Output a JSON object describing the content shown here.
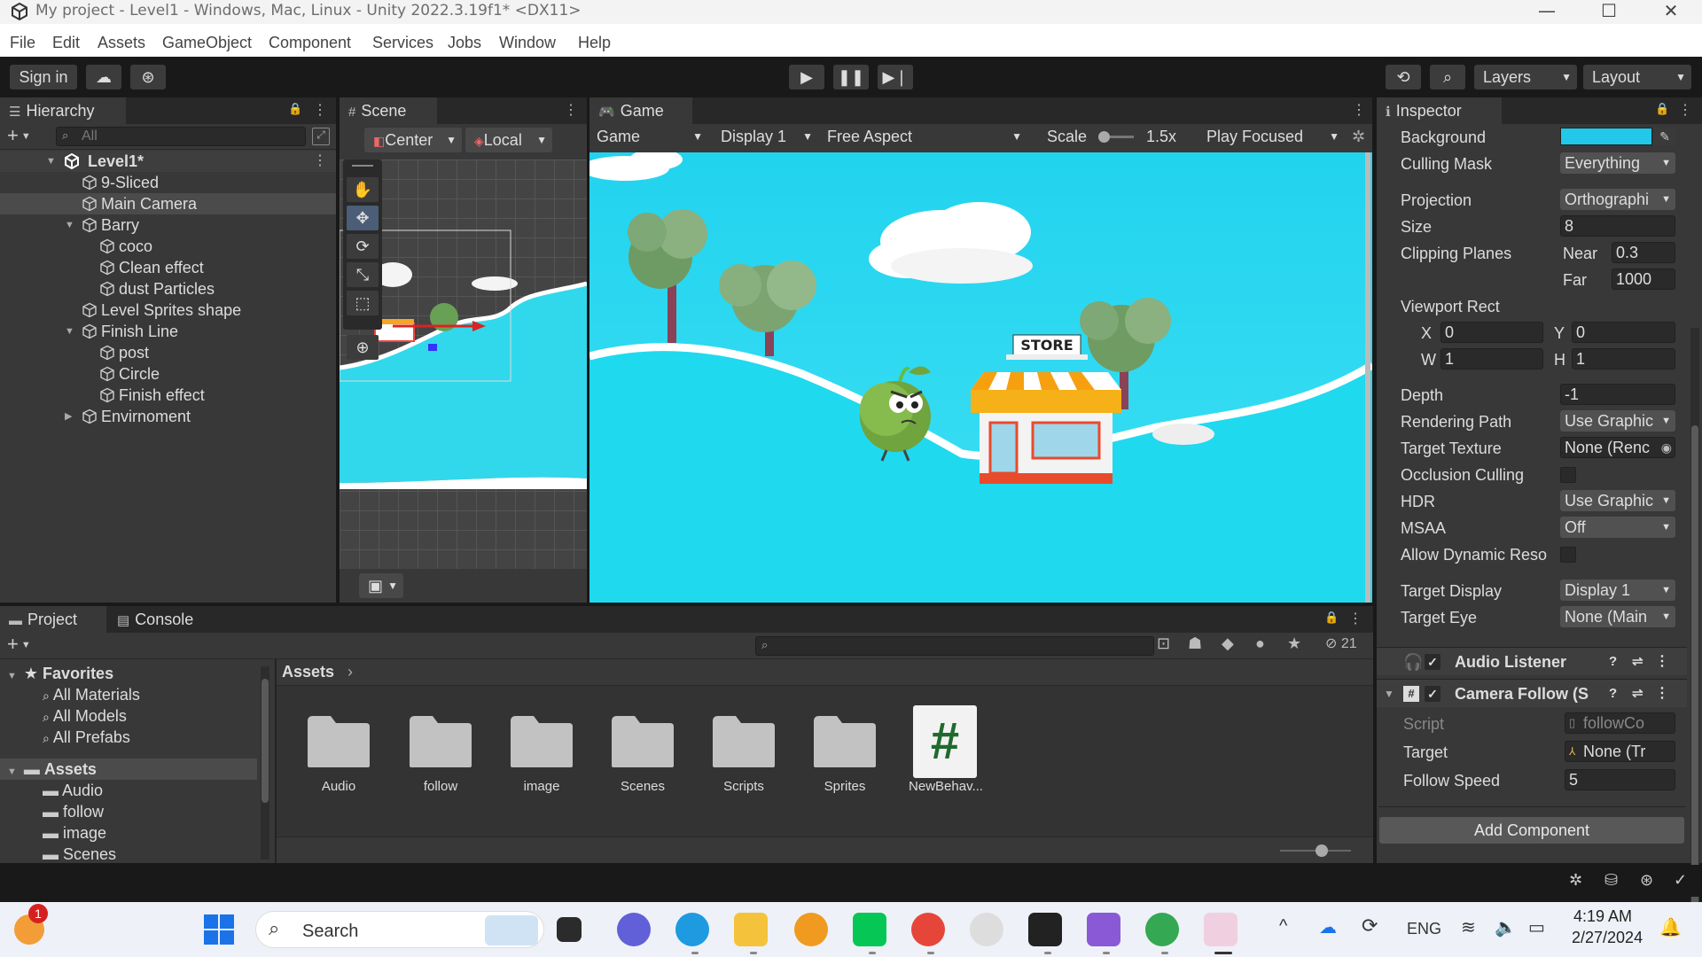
{
  "window": {
    "title": "My project - Level1 - Windows, Mac, Linux - Unity 2022.3.19f1* <DX11>"
  },
  "menu": [
    "File",
    "Edit",
    "Assets",
    "GameObject",
    "Component",
    "Services",
    "Jobs",
    "Window",
    "Help"
  ],
  "toolbar": {
    "sign_in": "Sign in",
    "layers": "Layers",
    "layout": "Layout"
  },
  "hierarchy": {
    "title": "Hierarchy",
    "search_placeholder": "All",
    "scene": "Level1*",
    "items": [
      {
        "label": "9-Sliced"
      },
      {
        "label": "Main Camera"
      },
      {
        "label": "Barry"
      },
      {
        "label": "coco"
      },
      {
        "label": "Clean effect"
      },
      {
        "label": "dust Particles"
      },
      {
        "label": "Level Sprites shape"
      },
      {
        "label": "Finish Line"
      },
      {
        "label": "post"
      },
      {
        "label": "Circle"
      },
      {
        "label": "Finish effect"
      },
      {
        "label": "Envirnoment"
      }
    ]
  },
  "scene_view": {
    "title": "Scene",
    "pivot": "Center",
    "space": "Local"
  },
  "game_view": {
    "title": "Game",
    "mode": "Game",
    "display": "Display 1",
    "aspect": "Free Aspect",
    "scale_label": "Scale",
    "scale_value": "1.5x",
    "play_mode": "Play Focused",
    "store_sign": "STORE"
  },
  "inspector": {
    "title": "Inspector",
    "background_color": "#22c8ea",
    "rows": {
      "background": "Background",
      "culling_mask": "Culling Mask",
      "culling_mask_value": "Everything",
      "projection": "Projection",
      "projection_value": "Orthographi",
      "size": "Size",
      "size_value": "8",
      "clipping_planes": "Clipping Planes",
      "near": "Near",
      "near_value": "0.3",
      "far": "Far",
      "far_value": "1000",
      "viewport_rect": "Viewport Rect",
      "x": "X",
      "x_value": "0",
      "y": "Y",
      "y_value": "0",
      "w": "W",
      "w_value": "1",
      "h": "H",
      "h_value": "1",
      "depth": "Depth",
      "depth_value": "-1",
      "rendering_path": "Rendering Path",
      "rendering_path_value": "Use Graphic",
      "target_texture": "Target Texture",
      "target_texture_value": "None (Renc",
      "occlusion_culling": "Occlusion Culling",
      "hdr": "HDR",
      "hdr_value": "Use Graphic",
      "msaa": "MSAA",
      "msaa_value": "Off",
      "allow_dynamic": "Allow Dynamic Reso",
      "target_display": "Target Display",
      "target_display_value": "Display 1",
      "target_eye": "Target Eye",
      "target_eye_value": "None (Main"
    },
    "components": {
      "audio_listener": "Audio Listener",
      "camera_follow": "Camera Follow (S",
      "script_label": "Script",
      "script_value": "followCo",
      "target_label": "Target",
      "target_value": "None (Tr",
      "follow_speed_label": "Follow Speed",
      "follow_speed_value": "5"
    },
    "add_component": "Add Component"
  },
  "project": {
    "tab_project": "Project",
    "tab_console": "Console",
    "hidden_count": "21",
    "breadcrumb": "Assets",
    "tree": [
      {
        "label": "Favorites"
      },
      {
        "label": "All Materials"
      },
      {
        "label": "All Models"
      },
      {
        "label": "All Prefabs"
      },
      {
        "label": "Assets"
      },
      {
        "label": "Audio"
      },
      {
        "label": "follow"
      },
      {
        "label": "image"
      },
      {
        "label": "Scenes"
      }
    ],
    "assets": [
      {
        "label": "Audio"
      },
      {
        "label": "follow"
      },
      {
        "label": "image"
      },
      {
        "label": "Scenes"
      },
      {
        "label": "Scripts"
      },
      {
        "label": "Sprites"
      },
      {
        "label": "NewBehav..."
      }
    ]
  },
  "taskbar": {
    "search": "Search",
    "lang": "ENG",
    "time": "4:19 AM",
    "date": "2/27/2024",
    "notification_count": "1"
  }
}
